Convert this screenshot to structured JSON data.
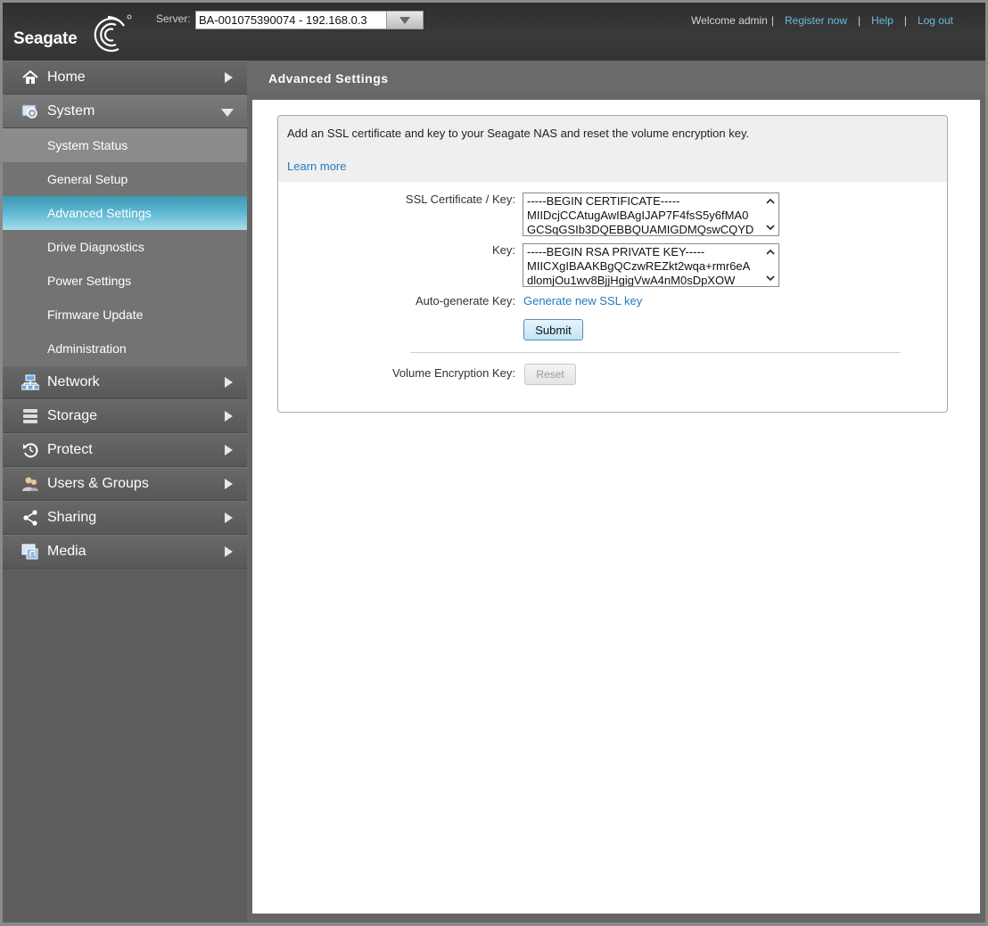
{
  "header": {
    "logo_text": "Seagate",
    "server_label": "Server:",
    "server_value": "BA-001075390074 - 192.168.0.3",
    "welcome": "Welcome admin",
    "register": "Register now",
    "help": "Help",
    "logout": "Log out",
    "separator": "|"
  },
  "sidebar": {
    "items": [
      {
        "label": "Home",
        "icon": "home-icon"
      },
      {
        "label": "System",
        "icon": "system-icon"
      },
      {
        "label": "Network",
        "icon": "network-icon"
      },
      {
        "label": "Storage",
        "icon": "storage-icon"
      },
      {
        "label": "Protect",
        "icon": "protect-icon"
      },
      {
        "label": "Users & Groups",
        "icon": "users-icon"
      },
      {
        "label": "Sharing",
        "icon": "sharing-icon"
      },
      {
        "label": "Media",
        "icon": "media-icon"
      }
    ],
    "system_sub": [
      "System Status",
      "General Setup",
      "Advanced Settings",
      "Drive Diagnostics",
      "Power Settings",
      "Firmware Update",
      "Administration"
    ],
    "active_sub": "Advanced Settings"
  },
  "page": {
    "title": "Advanced Settings",
    "intro": "Add an SSL certificate and key to your Seagate NAS and reset the volume encryption key.",
    "learn_more": "Learn more",
    "ssl_label": "SSL Certificate / Key:",
    "ssl_value": "-----BEGIN CERTIFICATE-----\nMIIDcjCCAtugAwIBAgIJAP7F4fsS5y6fMA0\nGCSqGSIb3DQEBBQUAMIGDMQswCQYD",
    "key_label": "Key:",
    "key_value": "-----BEGIN RSA PRIVATE KEY-----\nMIICXgIBAAKBgQCzwREZkt2wqa+rmr6eA\ndlomjOu1wv8BjjHgigVwA4nM0sDpXOW",
    "autogen_label": "Auto-generate Key:",
    "autogen_link": "Generate new SSL key",
    "submit": "Submit",
    "vek_label": "Volume Encryption Key:",
    "reset": "Reset"
  },
  "colors": {
    "accent": "#5fb9d4",
    "link": "#1f7bbf",
    "header_link": "#6cb9e0"
  }
}
